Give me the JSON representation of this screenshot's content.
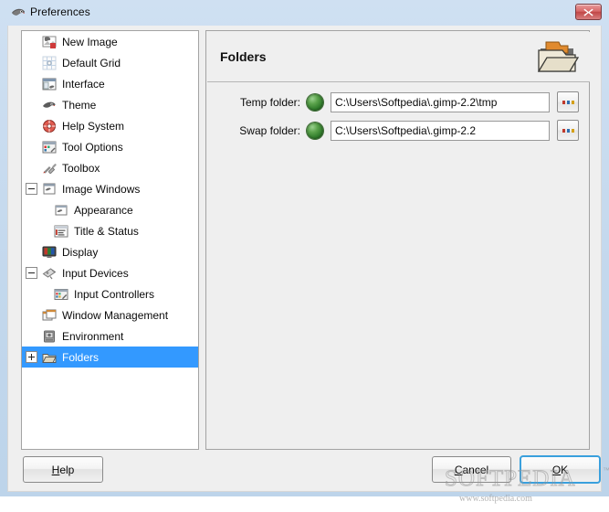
{
  "window": {
    "title": "Preferences",
    "icon": "wilber-icon",
    "close_label": "Close"
  },
  "sidebar": {
    "items": [
      {
        "label": "New Image",
        "icon": "new-image-icon",
        "level": 1,
        "expander": "none",
        "selected": false
      },
      {
        "label": "Default Grid",
        "icon": "default-grid-icon",
        "level": 1,
        "expander": "none",
        "selected": false
      },
      {
        "label": "Interface",
        "icon": "interface-icon",
        "level": 1,
        "expander": "none",
        "selected": false
      },
      {
        "label": "Theme",
        "icon": "theme-icon",
        "level": 1,
        "expander": "none",
        "selected": false
      },
      {
        "label": "Help System",
        "icon": "help-system-icon",
        "level": 1,
        "expander": "none",
        "selected": false
      },
      {
        "label": "Tool Options",
        "icon": "tool-options-icon",
        "level": 1,
        "expander": "none",
        "selected": false
      },
      {
        "label": "Toolbox",
        "icon": "toolbox-icon",
        "level": 1,
        "expander": "none",
        "selected": false
      },
      {
        "label": "Image Windows",
        "icon": "image-windows-icon",
        "level": 1,
        "expander": "minus",
        "selected": false
      },
      {
        "label": "Appearance",
        "icon": "appearance-icon",
        "level": 2,
        "expander": "none",
        "selected": false
      },
      {
        "label": "Title & Status",
        "icon": "title-status-icon",
        "level": 2,
        "expander": "none",
        "selected": false
      },
      {
        "label": "Display",
        "icon": "display-icon",
        "level": 1,
        "expander": "none",
        "selected": false
      },
      {
        "label": "Input Devices",
        "icon": "input-devices-icon",
        "level": 1,
        "expander": "minus",
        "selected": false
      },
      {
        "label": "Input Controllers",
        "icon": "input-controllers-icon",
        "level": 2,
        "expander": "none",
        "selected": false
      },
      {
        "label": "Window Management",
        "icon": "window-management-icon",
        "level": 1,
        "expander": "none",
        "selected": false
      },
      {
        "label": "Environment",
        "icon": "environment-icon",
        "level": 1,
        "expander": "none",
        "selected": false
      },
      {
        "label": "Folders",
        "icon": "folders-icon",
        "level": 1,
        "expander": "plus",
        "selected": true
      }
    ]
  },
  "content": {
    "title": "Folders",
    "header_icon": "open-folder-icon",
    "fields": [
      {
        "label": "Temp folder:",
        "value": "C:\\Users\\Softpedia\\.gimp-2.2\\tmp",
        "placeholder": "",
        "indicator": "green-led-icon",
        "browse_label": "..."
      },
      {
        "label": "Swap folder:",
        "value": "C:\\Users\\Softpedia\\.gimp-2.2",
        "placeholder": "",
        "indicator": "green-led-icon",
        "browse_label": "..."
      }
    ]
  },
  "buttons": {
    "help": {
      "pre": "H",
      "rest": "elp"
    },
    "cancel": {
      "pre": "C",
      "rest": "ancel"
    },
    "ok": {
      "pre": "O",
      "rest": "K"
    }
  },
  "watermark": {
    "main": "SOFTPEDIA",
    "tm": "™",
    "sub": "www.softpedia.com"
  },
  "colors": {
    "selection": "#3399ff",
    "titlebar": "#c3d8ed",
    "dialog_bg": "#efefef",
    "close_button": "#c14747",
    "led_green": "#5ba34c",
    "focus_ring": "#3aa0dd"
  }
}
